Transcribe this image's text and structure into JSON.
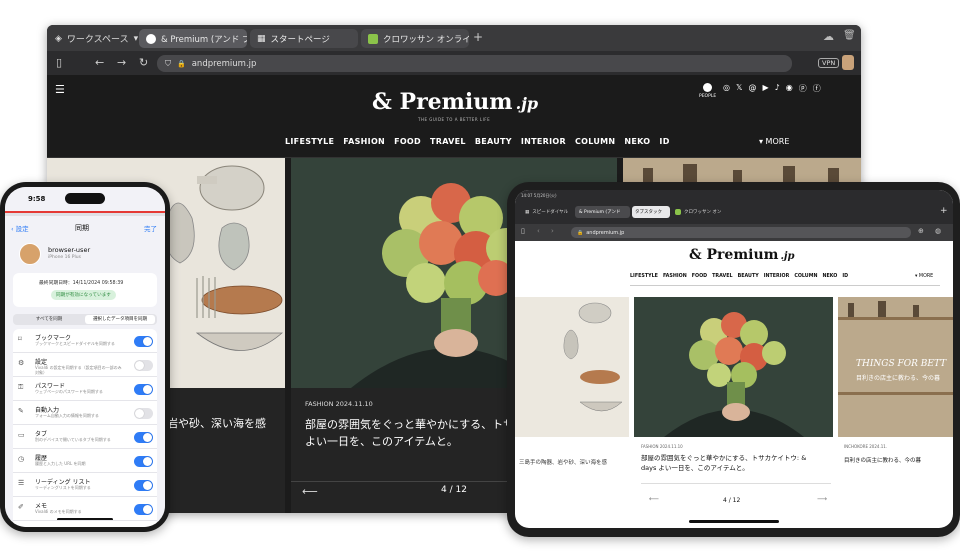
{
  "desktop": {
    "workspace_label": "ワークスペース",
    "tabs": [
      {
        "label": "& Premium (アンド プレミ",
        "active": true
      },
      {
        "label": "スタートページ",
        "active": false
      },
      {
        "label": "クロワッサン オンライン-",
        "active": false
      }
    ],
    "url": "andpremium.jp",
    "vpn_label": "VPN"
  },
  "site": {
    "logo": "& Premium",
    "logo_suffix": ".jp",
    "tagline": "THE GUIDE TO A BETTER LIFE",
    "people_label": "PEOPLE",
    "menu": [
      "LIFESTYLE",
      "FASHION",
      "FOOD",
      "TRAVEL",
      "BEAUTY",
      "INTERIOR",
      "COLUMN",
      "NEKO",
      "ID"
    ],
    "more_label": "▾ MORE",
    "slide": {
      "category": "FASHION",
      "date": "2024.11.10",
      "title_line1": "部屋の雰囲気をぐっと華やかにする、トサカ",
      "title_line2": "よい一日を、このアイテムと。",
      "left_text": "岩や砂、深い海を感",
      "pager": "4 / 12"
    }
  },
  "phone": {
    "time": "9:58",
    "back_label": "設定",
    "title": "同期",
    "done_label": "完了",
    "user_name": "browser-user",
    "device_name": "iPhone 16 Plus",
    "last_sync": "最終同期日時：14/11/2024 09:58:39",
    "sync_status": "同期が有効になっています",
    "seg_all": "すべてを同期",
    "seg_selected": "選択したデータ項目を同期",
    "rows": [
      {
        "label": "ブックマーク",
        "sub": "ブックマークとスピードダイヤルを同期する",
        "on": true
      },
      {
        "label": "設定",
        "sub": "Vivaldi の設定を同期する（設定項目の一部のみ対象）",
        "on": false
      },
      {
        "label": "パスワード",
        "sub": "ウェブページのパスワードを同期する",
        "on": true
      },
      {
        "label": "自動入力",
        "sub": "フォーム自動入力の情報を同期する",
        "on": false
      },
      {
        "label": "タブ",
        "sub": "別のデバイスで開いているタブを同期する",
        "on": true
      },
      {
        "label": "履歴",
        "sub": "履歴と入力した URL を同期",
        "on": true
      },
      {
        "label": "リーディング リスト",
        "sub": "リーディングリストを同期する",
        "on": true
      },
      {
        "label": "メモ",
        "sub": "Vivaldi のメモを同期する",
        "on": true
      }
    ]
  },
  "tablet": {
    "time": "14:07 5月20日(火)",
    "tabs": [
      "スピードダイヤル",
      "& Premium (アンド",
      "タブスタック",
      "クロワッサン オン"
    ],
    "url": "andpremium.jp",
    "logo": "& Premium",
    "logo_suffix": ".jp",
    "menu": [
      "LIFESTYLE",
      "FASHION",
      "FOOD",
      "TRAVEL",
      "BEAUTY",
      "INTERIOR",
      "COLUMN",
      "NEKO",
      "ID"
    ],
    "more_label": "▾ MORE",
    "slide": {
      "category": "FASHION",
      "date": "2024.11.10",
      "title_line1": "部屋の雰囲気をぐっと華やかにする、トサカケイトウ: &",
      "title_line2": "days よい一日を、このアイテムと。",
      "left_text": "三島手の陶器、岩や砂、深い海を感",
      "right_heading": "THINGS FOR BETT",
      "right_category": "INCHOKORE",
      "right_date": "2024.11.",
      "right_text": "目利きの店主に教わる、今の暮",
      "pager": "4 / 12"
    }
  },
  "colors": {
    "accent_blue": "#2f7cf6",
    "site_bg": "#1b1b1b",
    "sync_green_bg": "#d8f1dc",
    "sync_green_text": "#2c8a3e"
  }
}
